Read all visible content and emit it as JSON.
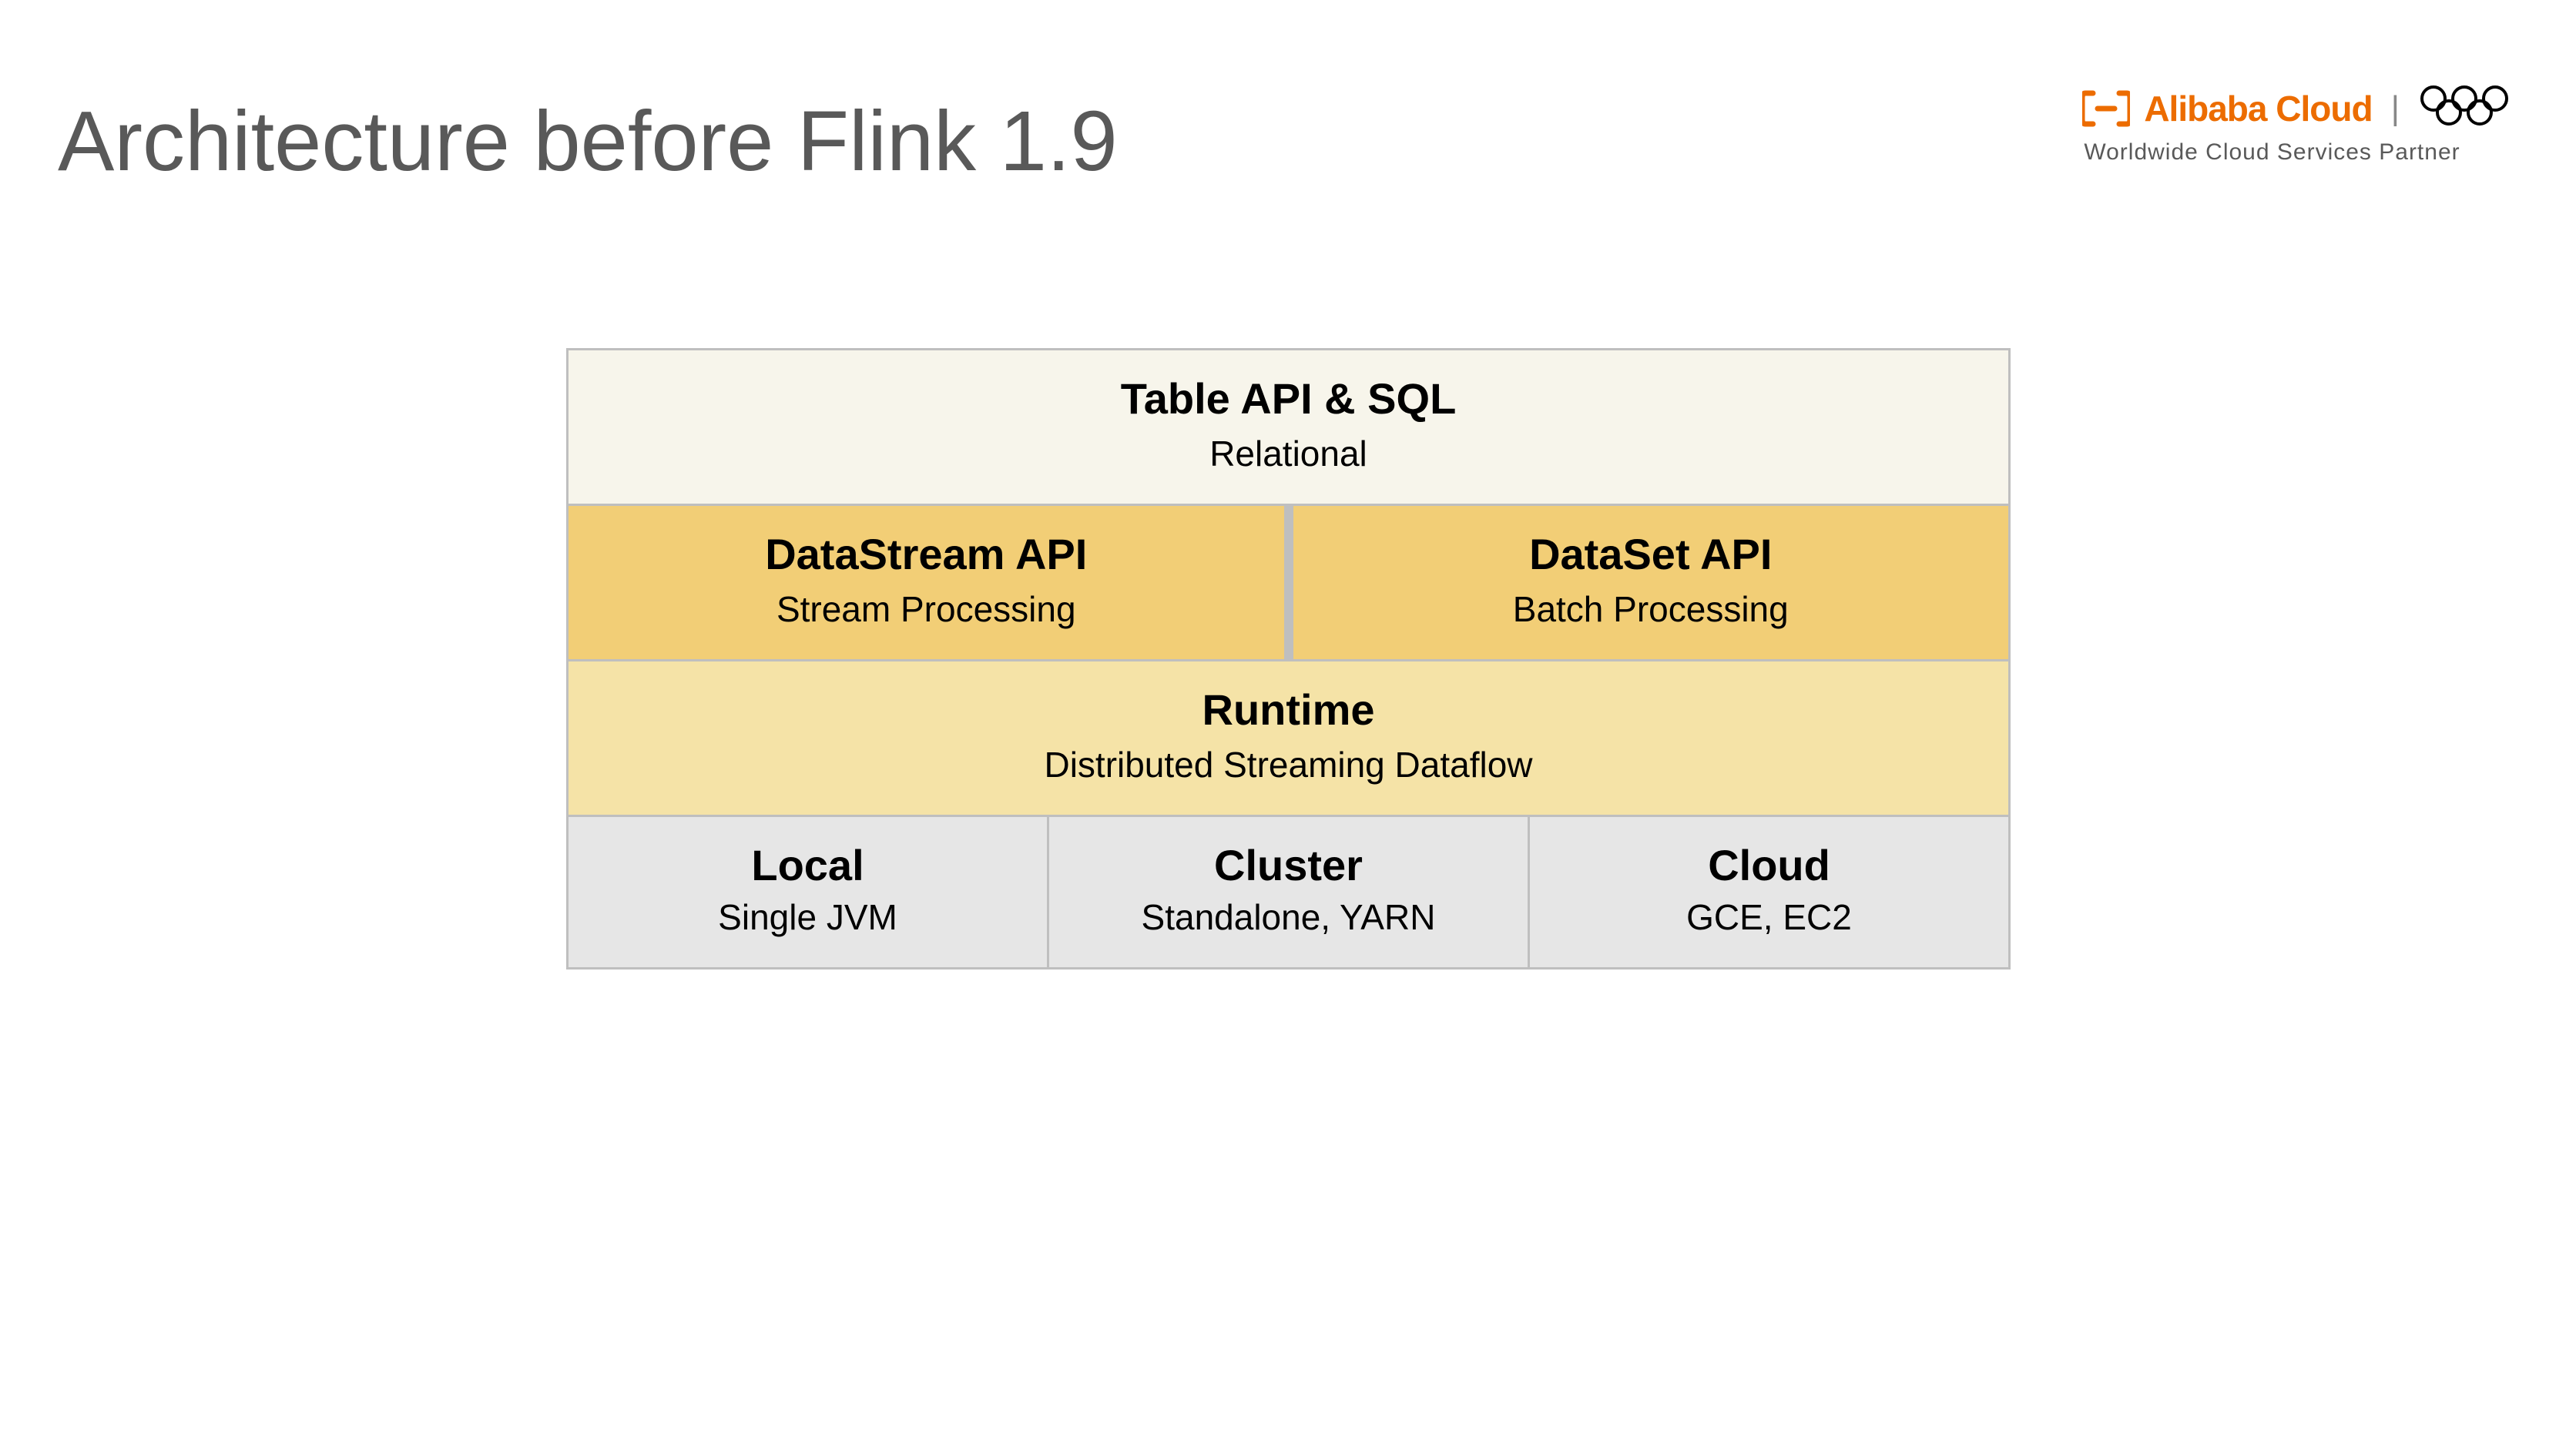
{
  "title": "Architecture before Flink 1.9",
  "logo": {
    "brand": "Alibaba Cloud",
    "tagline": "Worldwide Cloud Services Partner"
  },
  "diagram": {
    "top": {
      "title": "Table API & SQL",
      "subtitle": "Relational"
    },
    "api_left": {
      "title": "DataStream API",
      "subtitle": "Stream Processing"
    },
    "api_right": {
      "title": "DataSet API",
      "subtitle": "Batch Processing"
    },
    "runtime": {
      "title": "Runtime",
      "subtitle": "Distributed Streaming Dataflow"
    },
    "deploy": [
      {
        "title": "Local",
        "subtitle": "Single JVM"
      },
      {
        "title": "Cluster",
        "subtitle": "Standalone, YARN"
      },
      {
        "title": "Cloud",
        "subtitle": "GCE, EC2"
      }
    ]
  }
}
